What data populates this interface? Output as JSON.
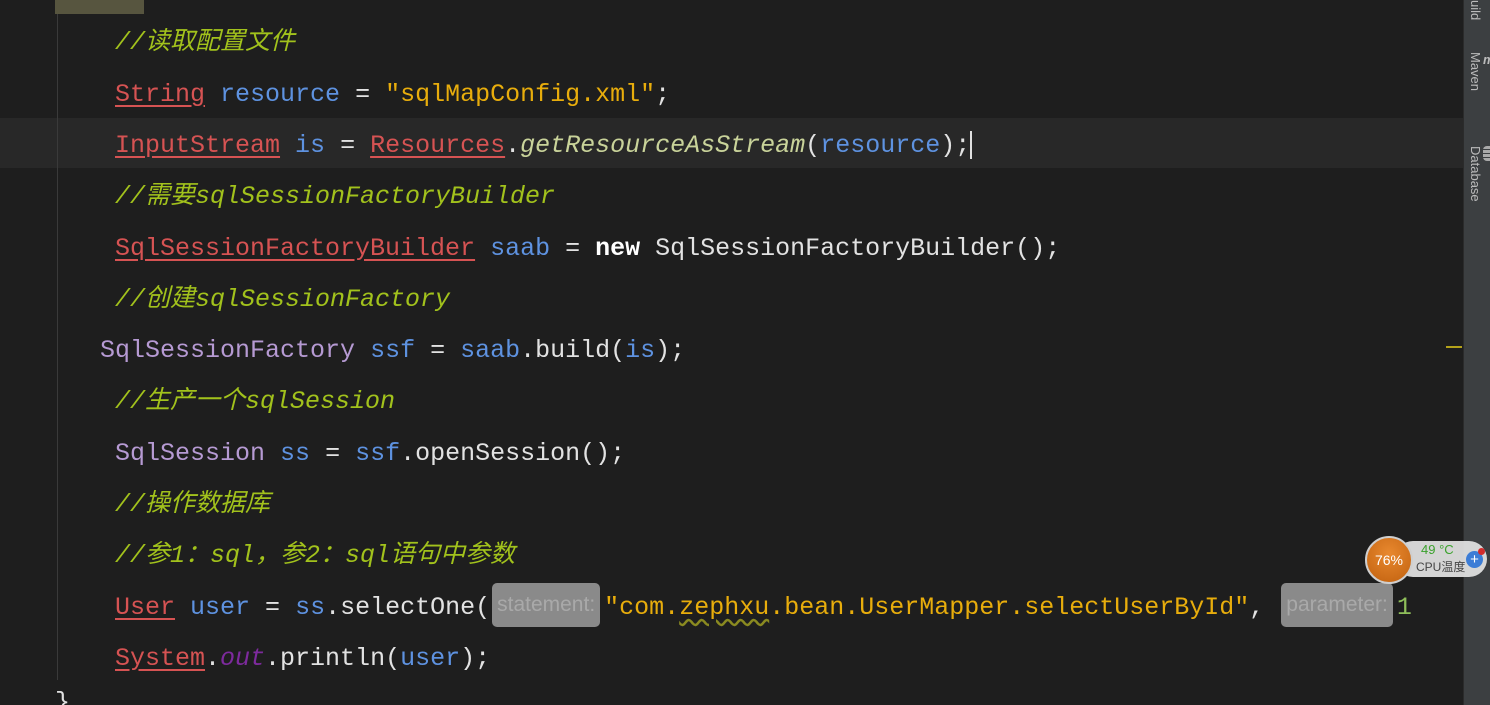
{
  "editor": {
    "lines": [
      {
        "indent": 115,
        "tokens": []
      },
      {
        "indent": 115,
        "tokens": [
          {
            "t": "//读取配置文件",
            "c": "c"
          }
        ]
      },
      {
        "indent": 115,
        "tokens": [
          {
            "t": "String",
            "c": "r"
          },
          {
            "t": " ",
            "c": "p"
          },
          {
            "t": "resource",
            "c": "v"
          },
          {
            "t": " = ",
            "c": "p"
          },
          {
            "t": "\"sqlMapConfig.xml\"",
            "c": "s"
          },
          {
            "t": ";",
            "c": "p"
          }
        ]
      },
      {
        "indent": 115,
        "current": true,
        "tokens": [
          {
            "t": "InputStream",
            "c": "r"
          },
          {
            "t": " ",
            "c": "p"
          },
          {
            "t": "is",
            "c": "v"
          },
          {
            "t": " = ",
            "c": "p"
          },
          {
            "t": "Resources",
            "c": "r"
          },
          {
            "t": ".",
            "c": "p"
          },
          {
            "t": "getResourceAsStream",
            "c": "m"
          },
          {
            "t": "(",
            "c": "p"
          },
          {
            "t": "resource",
            "c": "v"
          },
          {
            "t": ");",
            "c": "p"
          }
        ]
      },
      {
        "indent": 115,
        "tokens": [
          {
            "t": "//需要sqlSessionFactoryBuilder",
            "c": "c"
          }
        ]
      },
      {
        "indent": 115,
        "tokens": [
          {
            "t": "SqlSessionFactoryBuilder",
            "c": "r"
          },
          {
            "t": " ",
            "c": "p"
          },
          {
            "t": "saab",
            "c": "v"
          },
          {
            "t": " = ",
            "c": "p"
          },
          {
            "t": "new",
            "c": "k"
          },
          {
            "t": " SqlSessionFactoryBuilder();",
            "c": "p"
          }
        ]
      },
      {
        "indent": 115,
        "tokens": [
          {
            "t": "//创建sqlSessionFactory",
            "c": "c"
          }
        ]
      },
      {
        "indent": 100,
        "tokens": [
          {
            "t": "SqlSessionFactory",
            "c": "t"
          },
          {
            "t": " ",
            "c": "p"
          },
          {
            "t": "ssf",
            "c": "v"
          },
          {
            "t": " = ",
            "c": "p"
          },
          {
            "t": "saab",
            "c": "v"
          },
          {
            "t": ".build(",
            "c": "p"
          },
          {
            "t": "is",
            "c": "v"
          },
          {
            "t": ");",
            "c": "p"
          }
        ]
      },
      {
        "indent": 115,
        "tokens": [
          {
            "t": "//生产一个sqlSession",
            "c": "c"
          }
        ]
      },
      {
        "indent": 115,
        "tokens": [
          {
            "t": "SqlSession",
            "c": "t"
          },
          {
            "t": " ",
            "c": "p"
          },
          {
            "t": "ss",
            "c": "v"
          },
          {
            "t": " = ",
            "c": "p"
          },
          {
            "t": "ssf",
            "c": "v"
          },
          {
            "t": ".openSession();",
            "c": "p"
          }
        ]
      },
      {
        "indent": 115,
        "tokens": [
          {
            "t": "//操作数据库",
            "c": "c"
          }
        ]
      },
      {
        "indent": 115,
        "tokens": [
          {
            "t": "//参1：sql，参2：sql语句中参数",
            "c": "c"
          }
        ]
      },
      {
        "indent": 115,
        "tokens": [
          {
            "t": "User",
            "c": "r"
          },
          {
            "t": " ",
            "c": "p"
          },
          {
            "t": "user",
            "c": "v"
          },
          {
            "t": " = ",
            "c": "p"
          },
          {
            "t": "ss",
            "c": "v"
          },
          {
            "t": ".selectOne(",
            "c": "p"
          },
          {
            "t": "statement:",
            "c": "h"
          },
          {
            "t": "\"com.",
            "c": "s"
          },
          {
            "t": "zephxu",
            "c": "w"
          },
          {
            "t": ".bean.UserMapper.selectUserById\"",
            "c": "s"
          },
          {
            "t": ", ",
            "c": "p"
          },
          {
            "t": "parameter:",
            "c": "h"
          },
          {
            "t": "1",
            "c": "n"
          }
        ]
      },
      {
        "indent": 115,
        "tokens": [
          {
            "t": "System",
            "c": "r"
          },
          {
            "t": ".",
            "c": "p"
          },
          {
            "t": "out",
            "c": "o"
          },
          {
            "t": ".println(",
            "c": "p"
          },
          {
            "t": "user",
            "c": "v"
          },
          {
            "t": ");",
            "c": "p"
          }
        ]
      }
    ],
    "closing_brace": "}"
  },
  "right_toolbar": {
    "tabs": [
      {
        "label": "Build",
        "visible": "uild",
        "icon": "build-icon"
      },
      {
        "label": "Maven",
        "icon": "maven-icon"
      },
      {
        "label": "Database",
        "icon": "database-icon"
      }
    ]
  },
  "cpu_widget": {
    "usage": "76%",
    "temperature": "49 °C",
    "label": "CPU温度",
    "plus": "+"
  },
  "colors": {
    "background": "#1e1e1e",
    "current_line": "#282828",
    "type_error": "#d65353",
    "variable": "#5e92e0",
    "string": "#e8ad0c",
    "comment": "#a2c21c",
    "sidebar": "#3c3f41"
  }
}
